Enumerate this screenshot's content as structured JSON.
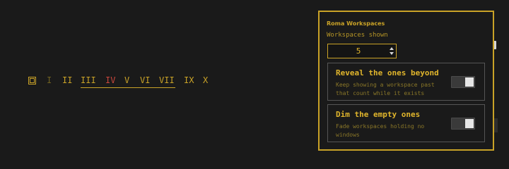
{
  "workspaces": [
    {
      "label": "I",
      "state": "empty"
    },
    {
      "label": "II",
      "state": "occupied"
    },
    {
      "label": "III",
      "state": "occupied"
    },
    {
      "label": "IV",
      "state": "focused"
    },
    {
      "label": "V",
      "state": "occupied"
    },
    {
      "label": "VI",
      "state": "occupied"
    },
    {
      "label": "VII",
      "state": "occupied"
    },
    {
      "label": "IX",
      "state": "occupied"
    },
    {
      "label": "X",
      "state": "occupied"
    }
  ],
  "panel": {
    "title": "Roma Workspaces",
    "shown_label": "Workspaces shown",
    "shown_value": "5",
    "reveal": {
      "title": "Reveal the ones beyond",
      "description": "Keep showing a workspace past that count while it exists",
      "enabled": false
    },
    "dim": {
      "title": "Dim the empty ones",
      "description": "Fade workspaces holding no windows",
      "enabled": false
    }
  },
  "colors": {
    "accent": "#c9a227",
    "focused": "#c9463c",
    "empty": "#6f6120",
    "background": "#1a1a1a"
  },
  "icons": {
    "overview": "window-square-icon"
  }
}
